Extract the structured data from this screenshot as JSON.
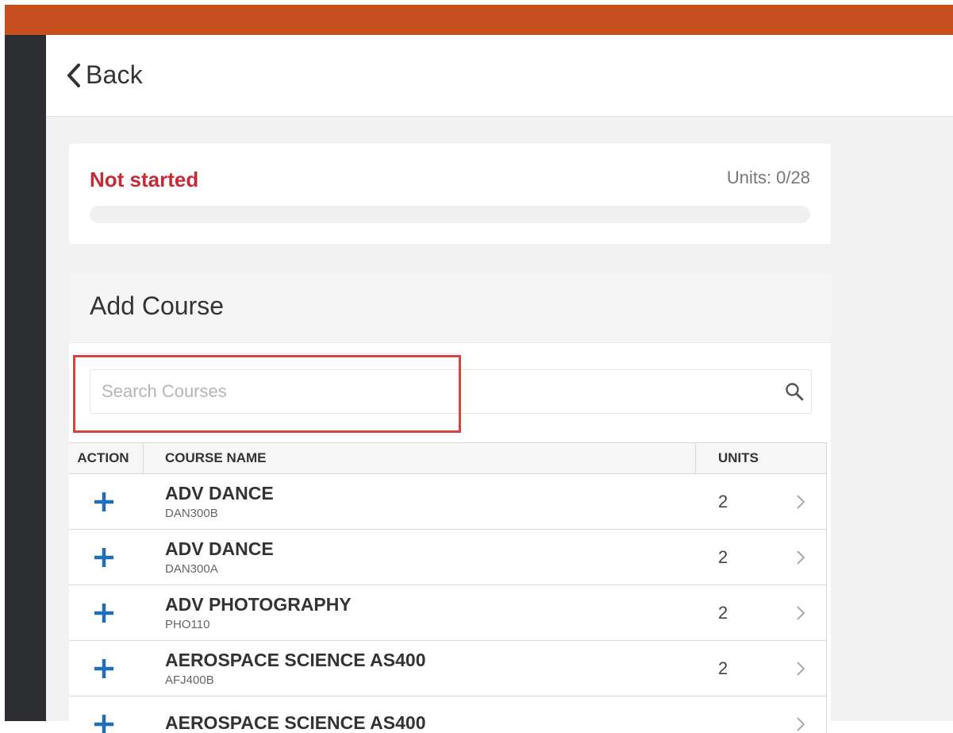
{
  "header": {
    "back_label": "Back"
  },
  "progress": {
    "status": "Not started",
    "units_label": "Units: 0/28",
    "fraction": 0,
    "status_color": "#c62a35"
  },
  "add_course": {
    "title": "Add Course",
    "search_placeholder": "Search Courses",
    "columns": {
      "action": "ACTION",
      "name": "COURSE NAME",
      "units": "UNITS"
    },
    "courses": [
      {
        "name": "ADV DANCE",
        "code": "DAN300B",
        "units": "2"
      },
      {
        "name": "ADV DANCE",
        "code": "DAN300A",
        "units": "2"
      },
      {
        "name": "ADV PHOTOGRAPHY",
        "code": "PHO110",
        "units": "2"
      },
      {
        "name": "AEROSPACE SCIENCE AS400",
        "code": "AFJ400B",
        "units": "2"
      },
      {
        "name": "AEROSPACE SCIENCE AS400",
        "code": "",
        "units": ""
      }
    ]
  },
  "colors": {
    "topbar": "#c44e1d",
    "sidebar": "#2b2d30",
    "accent": "#1f6fb8",
    "highlight": "#d9433c"
  },
  "icons": {
    "back": "chevron-left-icon",
    "search": "search-icon",
    "add": "plus-icon",
    "row": "chevron-right-icon"
  }
}
